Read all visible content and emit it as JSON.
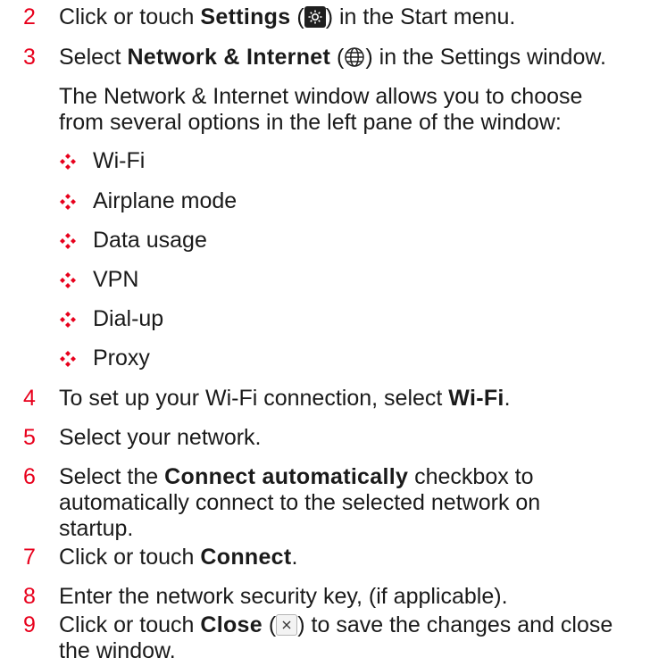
{
  "colors": {
    "step_number": "#e8001c",
    "text": "#1a1a1a"
  },
  "steps": [
    {
      "number": "2",
      "before": "Click or touch ",
      "bold": "Settings",
      "after_icon_open": " (",
      "icon": "gear-icon",
      "after": ") in the Start menu."
    },
    {
      "number": "3",
      "before": "Select ",
      "bold": "Network & Internet",
      "after_icon_open": " (",
      "icon": "globe-icon",
      "after": ") in the Settings window."
    },
    {
      "number": "4",
      "before": "To set up your Wi-Fi connection, select ",
      "bold": "Wi-Fi",
      "after": "."
    },
    {
      "number": "5",
      "text": "Select your network."
    },
    {
      "number": "6",
      "before": "Select the ",
      "bold": "Connect automatically",
      "after_line1": " checkbox to",
      "line2": "automatically connect to the selected network on",
      "line3": "startup."
    },
    {
      "number": "7",
      "before": "Click or touch ",
      "bold": "Connect",
      "after": "."
    },
    {
      "number": "8",
      "text": "Enter the network security key, (if applicable)."
    },
    {
      "number": "9",
      "before": "Click or touch ",
      "bold": "Close",
      "after_icon_open": " (",
      "icon": "close-icon",
      "after_line1": ") to save the changes and close",
      "line2": "the window."
    }
  ],
  "intro": {
    "line1": "The Network & Internet window allows you to choose",
    "line2": "from several options in the left pane of the window:"
  },
  "bullet_icon": "red-diamond-cluster-icon",
  "options": [
    "Wi-Fi",
    "Airplane mode",
    "Data usage",
    "VPN",
    "Dial-up",
    "Proxy"
  ]
}
